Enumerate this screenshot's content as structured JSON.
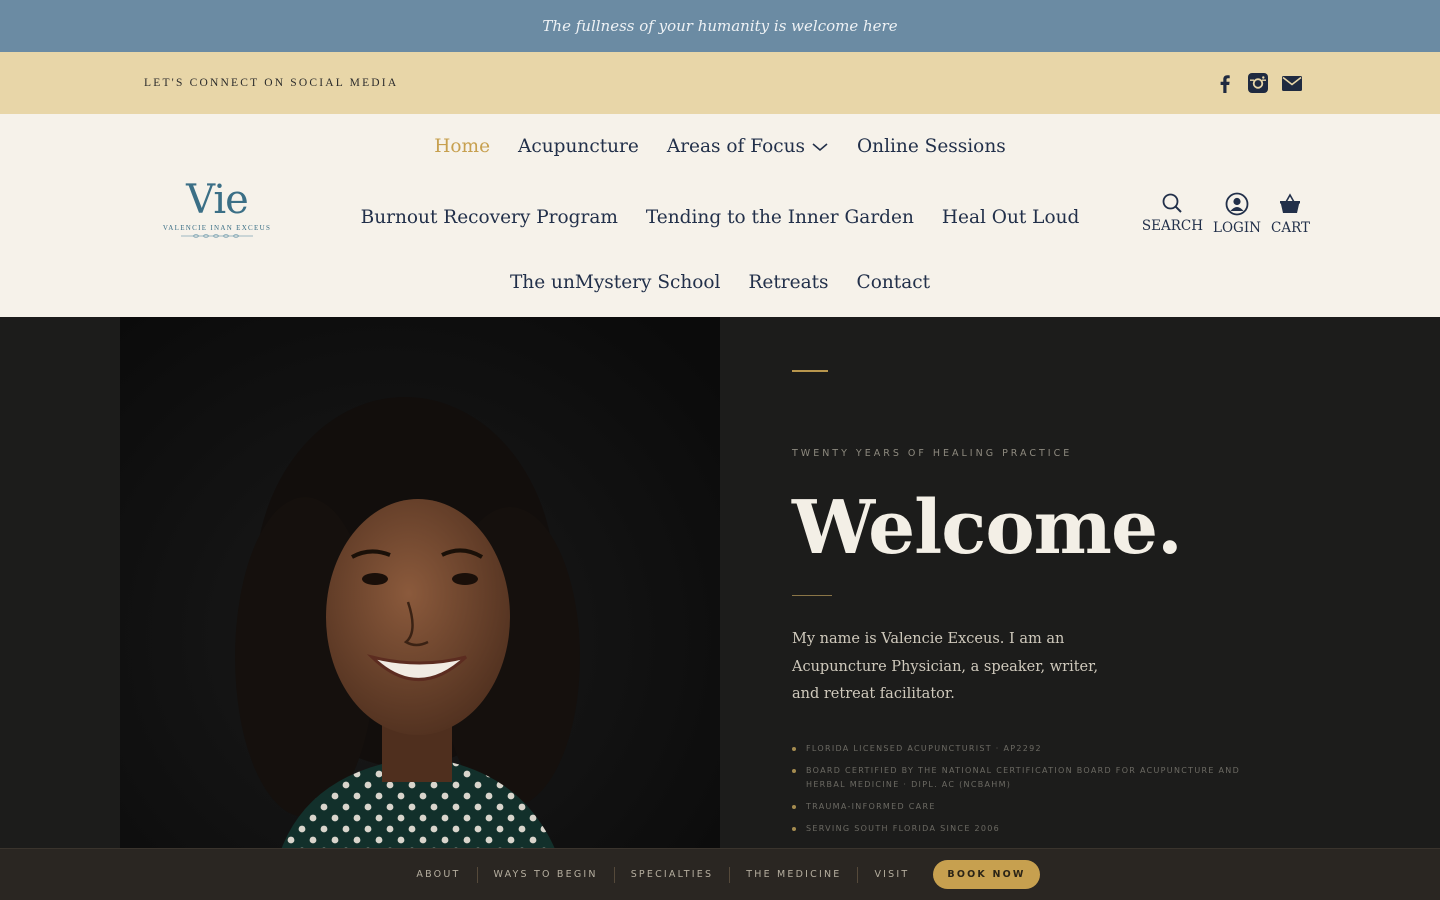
{
  "announcement": {
    "text": "The fullness of your humanity is welcome here"
  },
  "social_bar": {
    "label": "LET'S CONNECT ON SOCIAL MEDIA",
    "icons": [
      "facebook-icon",
      "instagram-icon",
      "email-icon"
    ]
  },
  "logo": {
    "mark": "Vie",
    "subtitle": "VALENCIE INAN EXCEUS"
  },
  "nav": {
    "row1": [
      "Home",
      "Acupuncture",
      "Areas of Focus",
      "Online Sessions"
    ],
    "row2": [
      "Burnout Recovery Program",
      "Tending to the Inner Garden",
      "Heal Out Loud"
    ],
    "row3": [
      "The unMystery School",
      "Retreats",
      "Contact"
    ],
    "active": "Home"
  },
  "tools": {
    "search": "SEARCH",
    "login": "LOGIN",
    "cart": "CART"
  },
  "hero": {
    "eyebrow": "TWENTY YEARS OF HEALING PRACTICE",
    "heading": "Welcome.",
    "intro": "My name is Valencie Exceus. I am an Acupuncture Physician, a speaker, writer, and retreat facilitator.",
    "credentials": [
      "FLORIDA LICENSED ACUPUNCTURIST · AP2292",
      "BOARD CERTIFIED BY THE NATIONAL CERTIFICATION BOARD FOR ACUPUNCTURE AND HERBAL MEDICINE · DIPL. AC (NCBAHM)",
      "TRAUMA-INFORMED CARE",
      "SERVING SOUTH FLORIDA SINCE 2006"
    ]
  },
  "bottom_nav": {
    "items": [
      "ABOUT",
      "WAYS TO BEGIN",
      "SPECIALTIES",
      "THE MEDICINE",
      "VISIT"
    ],
    "cta": "BOOK NOW"
  },
  "colors": {
    "announce_bg": "#6b8ba3",
    "social_bg": "#e8d6a8",
    "header_bg": "#f6f2ea",
    "accent_gold": "#c7a04f",
    "nav_text": "#22304a",
    "hero_bg": "#1c1c1b"
  }
}
